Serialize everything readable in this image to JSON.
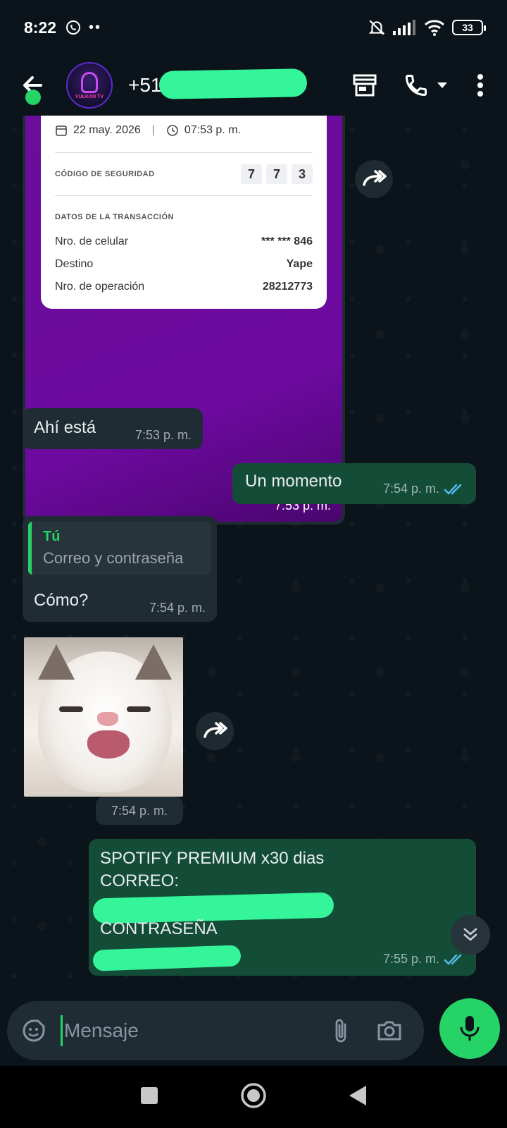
{
  "status_bar": {
    "time": "8:22",
    "dots": "••",
    "battery": "33"
  },
  "header": {
    "contact_prefix": "+51",
    "avatar_text": "VULKAN TV"
  },
  "receipt": {
    "date": "22 may. 2026",
    "time": "07:53 p. m.",
    "security_label": "CÓDIGO DE SEGURIDAD",
    "security_digits": [
      "7",
      "7",
      "3"
    ],
    "transaction_label": "DATOS DE LA TRANSACCIÓN",
    "rows": [
      {
        "label": "Nro. de celular",
        "value": "*** *** 846"
      },
      {
        "label": "Destino",
        "value": "Yape"
      },
      {
        "label": "Nro. de operación",
        "value": "28212773"
      }
    ],
    "bubble_time": "7:53 p. m."
  },
  "messages": {
    "m1": {
      "text": "Ahí está",
      "time": "7:53 p. m."
    },
    "m2": {
      "text": "Un momento",
      "time": "7:54 p. m."
    },
    "m3": {
      "quote_author": "Tú",
      "quote_text": "Correo y contraseña",
      "text": "Cómo?",
      "time": "7:54 p. m."
    },
    "sticker_time": "7:54 p. m.",
    "m4": {
      "line1": "SPOTIFY PREMIUM x30  dias",
      "line2": "CORREO:",
      "line4": "CONTRASEÑA",
      "time": "7:55 p. m."
    }
  },
  "composer": {
    "placeholder": "Mensaje"
  },
  "colors": {
    "background": "#0b141a",
    "incoming": "#1f2c34",
    "outgoing": "#144d37",
    "accent": "#25d366",
    "read_ticks": "#53bdeb",
    "redaction": "#34f59a"
  }
}
